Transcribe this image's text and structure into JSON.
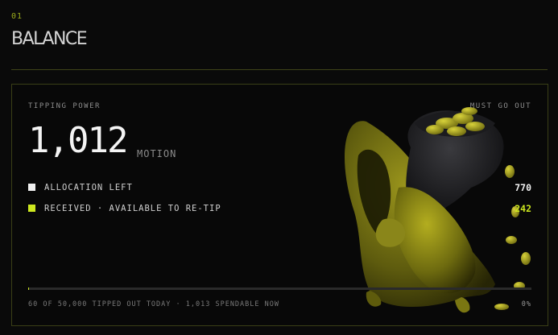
{
  "section": {
    "number": "01",
    "title": "BALANCE"
  },
  "card": {
    "tipping_power_label": "TIPPING POWER",
    "must_go_out_label": "MUST GO OUT",
    "total_value": "1,012",
    "unit": "MOTION",
    "legend": [
      {
        "label": "ALLOCATION LEFT",
        "value": "770",
        "color": "#f0f0f0"
      },
      {
        "label": "RECEIVED · AVAILABLE TO RE-TIP",
        "value": "242",
        "color": "#cde81f"
      }
    ],
    "progress": {
      "fraction": 0.0012,
      "footer": "60 OF 50,000 TIPPED OUT TODAY · 1,013 SPENDABLE NOW",
      "percent_label": "0%"
    },
    "illustration_icon": "money-bag-character-icon"
  },
  "colors": {
    "accent": "#cde81f",
    "background": "#0a0a0a",
    "border": "#3a3f16"
  }
}
